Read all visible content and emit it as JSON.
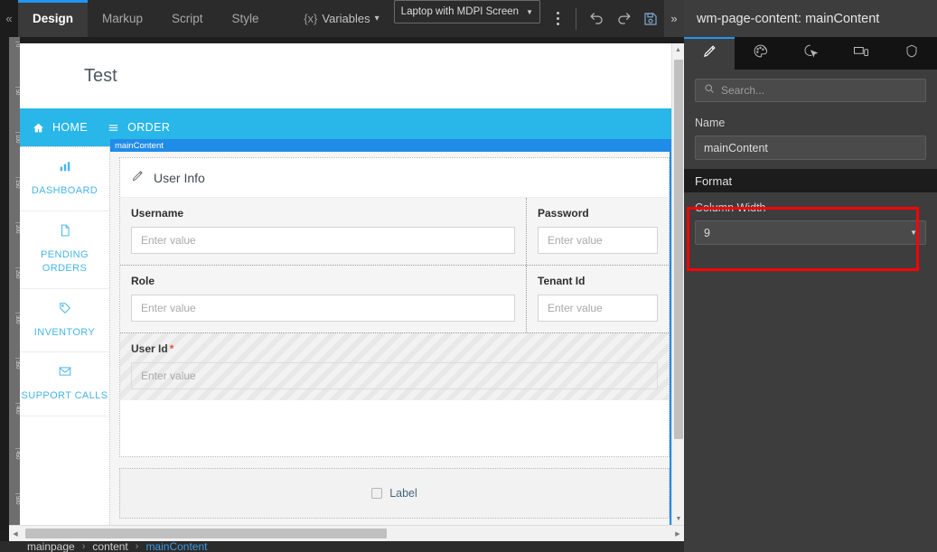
{
  "toolbar": {
    "collapse_icon": "chevron-left-double",
    "tabs": [
      {
        "label": "Design",
        "active": true
      },
      {
        "label": "Markup",
        "active": false
      },
      {
        "label": "Script",
        "active": false
      },
      {
        "label": "Style",
        "active": false
      }
    ],
    "variables_prefix": "{x}",
    "variables_label": "Variables",
    "variables_caret": "ⱟ",
    "device_selector": "Laptop with MDPI Screen",
    "device_caret": "▼",
    "kebab_label": "more-options",
    "undo_label": "undo",
    "redo_label": "redo",
    "save_label": "save",
    "expand_icon": "»"
  },
  "ruler": {
    "ticks": [
      "0",
      "50",
      "100",
      "150",
      "200",
      "250",
      "300",
      "350",
      "400",
      "450",
      "500"
    ]
  },
  "canvas": {
    "page_title": "Test",
    "selection_badge": "mainContent",
    "nav": [
      {
        "label": "HOME",
        "icon": "home-icon"
      },
      {
        "label": "ORDER",
        "icon": "list-icon"
      }
    ],
    "sidebar": [
      {
        "label": "DASHBOARD",
        "icon": "bar-chart-icon"
      },
      {
        "label": "PENDING ORDERS",
        "icon": "file-icon"
      },
      {
        "label": "INVENTORY",
        "icon": "tag-icon"
      },
      {
        "label": "SUPPORT CALLS",
        "icon": "envelope-icon"
      }
    ],
    "card": {
      "icon": "pencil-icon",
      "title": "User Info",
      "fields": [
        {
          "label": "Username",
          "placeholder": "Enter value",
          "required": false
        },
        {
          "label": "Password",
          "placeholder": "Enter value",
          "required": false
        },
        {
          "label": "Role",
          "placeholder": "Enter value",
          "required": false
        },
        {
          "label": "Tenant Id",
          "placeholder": "Enter value",
          "required": false
        },
        {
          "label": "User Id",
          "placeholder": "Enter value",
          "required": true,
          "required_mark": "*"
        }
      ]
    },
    "checkbox": {
      "label": "Label",
      "checked": false
    }
  },
  "breadcrumb": {
    "items": [
      "mainpage",
      "content",
      "mainContent"
    ],
    "separator": "›",
    "current_index": 2
  },
  "panel": {
    "title": "wm-page-content: mainContent",
    "tabs": [
      {
        "icon": "pencil-icon",
        "name": "properties",
        "active": true
      },
      {
        "icon": "palette-icon",
        "name": "style",
        "active": false
      },
      {
        "icon": "cursor-click-icon",
        "name": "events",
        "active": false
      },
      {
        "icon": "devices-icon",
        "name": "display",
        "active": false
      },
      {
        "icon": "shield-icon",
        "name": "security",
        "active": false
      }
    ],
    "search_placeholder": "Search...",
    "name_label": "Name",
    "name_value": "mainContent",
    "format_section": "Format",
    "column_width_label": "Column Width",
    "column_width_value": "9",
    "select_caret": "▼"
  },
  "colors": {
    "accent_blue": "#2196f3",
    "nav_cyan": "#29b6e8",
    "selection_blue": "#1f8ce8",
    "highlight_red": "#fb0007",
    "required_red": "#e8513f",
    "link_blue": "#3d9ae8"
  }
}
